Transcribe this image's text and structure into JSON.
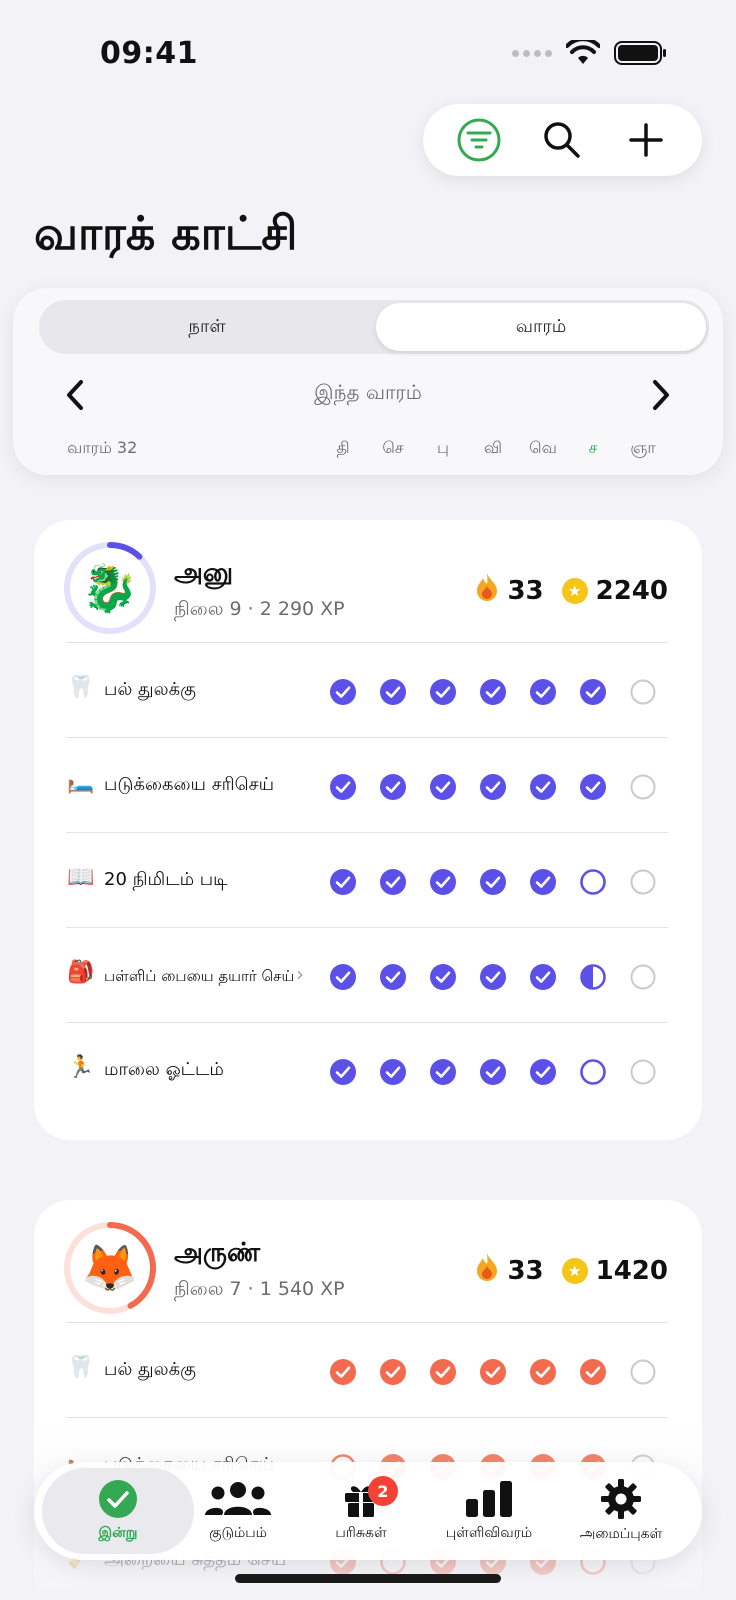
{
  "status_bar": {
    "time": "09:41"
  },
  "page": {
    "title": "வாரக் காட்சி"
  },
  "view_toggle": {
    "day_label": "நாள்",
    "week_label": "வாரம்",
    "selected": "week"
  },
  "week_nav": {
    "range_label": "இந்த வாரம்",
    "week_number": "வாரம் 32"
  },
  "days": [
    "தி",
    "செ",
    "பு",
    "வி",
    "வெ",
    "ச",
    "ஞா"
  ],
  "today_index": 5,
  "members": [
    {
      "name": "அனு",
      "avatar_icon": "dragon-emoji",
      "avatar_glyph": "🐉",
      "level_text": "நிலை 9 · 2 290 XP",
      "streak": "33",
      "points": "2240",
      "accent_color": "#5B51E8",
      "level_progress": 0.12,
      "tasks": [
        {
          "emoji": "🦷",
          "icon": "tooth-icon",
          "name": "பல் துலக்கு",
          "states": [
            "done",
            "done",
            "done",
            "done",
            "done",
            "done",
            "empty"
          ]
        },
        {
          "emoji": "🛏️",
          "icon": "bed-icon",
          "name": "படுக்கையை சரிசெய்",
          "states": [
            "done",
            "done",
            "done",
            "done",
            "done",
            "done",
            "empty"
          ]
        },
        {
          "emoji": "📖",
          "icon": "book-icon",
          "name": "20 நிமிடம் படி",
          "states": [
            "done",
            "done",
            "done",
            "done",
            "done",
            "pending",
            "empty"
          ]
        },
        {
          "emoji": "🎒",
          "icon": "backpack-icon",
          "name": "பள்ளிப் பையை தயார் செய்",
          "states": [
            "done",
            "done",
            "done",
            "done",
            "done",
            "half",
            "empty"
          ],
          "has_chevron": true
        },
        {
          "emoji": "🏃",
          "icon": "runner-icon",
          "name": "மாலை ஓட்டம்",
          "states": [
            "done",
            "done",
            "done",
            "done",
            "done",
            "pending",
            "empty"
          ]
        }
      ]
    },
    {
      "name": "அருண்",
      "avatar_icon": "fox-emoji",
      "avatar_glyph": "🦊",
      "level_text": "நிலை 7 · 1 540 XP",
      "streak": "33",
      "points": "1420",
      "accent_color": "#F26B4F",
      "level_progress": 0.42,
      "tasks": [
        {
          "emoji": "🦷",
          "icon": "tooth-icon",
          "name": "பல் துலக்கு",
          "states": [
            "done",
            "done",
            "done",
            "done",
            "done",
            "done",
            "empty"
          ]
        },
        {
          "emoji": "🛏️",
          "icon": "bed-icon",
          "name": "படுக்கையை சரிசெய்",
          "states": [
            "pending",
            "done",
            "done",
            "done",
            "done",
            "done",
            "empty"
          ]
        },
        {
          "emoji": "🧹",
          "icon": "broom-icon",
          "name": "அறையை சுத்தம் செய்",
          "states": [
            "done",
            "pending",
            "done",
            "done",
            "done",
            "pending",
            "empty"
          ]
        }
      ]
    }
  ],
  "tabbar": {
    "items": [
      {
        "label": "இன்று",
        "icon": "checkmark-circle-icon",
        "active": true
      },
      {
        "label": "குடும்பம்",
        "icon": "people-icon"
      },
      {
        "label": "பரிசுகள்",
        "icon": "gift-icon",
        "badge": "2"
      },
      {
        "label": "புள்ளிவிவரம்",
        "icon": "bar-chart-icon"
      },
      {
        "label": "அமைப்புகள்",
        "icon": "gear-icon"
      }
    ]
  },
  "colors": {
    "background": "#F2F2F7",
    "today": "#34A853",
    "filter_green": "#34A853"
  }
}
